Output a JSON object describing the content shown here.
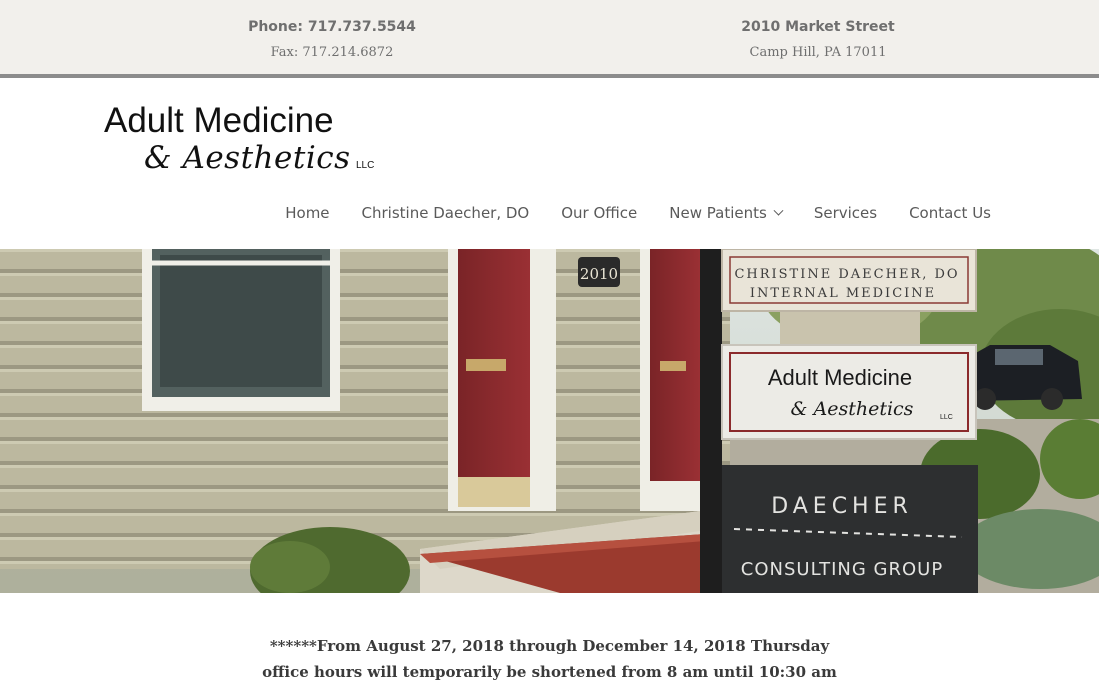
{
  "contact": {
    "phone": "Phone: 717.737.5544",
    "fax": "Fax: 717.214.6872",
    "street": "2010 Market Street",
    "city": "Camp Hill, PA 17011"
  },
  "logo": {
    "line1": "Adult Medicine",
    "line2": "& Aesthetics",
    "suffix": "LLC"
  },
  "nav": {
    "items": [
      {
        "label": "Home"
      },
      {
        "label": "Christine Daecher, DO"
      },
      {
        "label": "Our Office"
      },
      {
        "label": "New Patients",
        "has_dropdown": true
      },
      {
        "label": "Services"
      },
      {
        "label": "Contact Us"
      }
    ]
  },
  "hero": {
    "address_plaque": "2010",
    "sign_top_line1": "CHRISTINE DAECHER, DO",
    "sign_top_line2": "INTERNAL MEDICINE",
    "sign_mid_line1": "Adult Medicine",
    "sign_mid_line2": "& Aesthetics",
    "sign_mid_suffix": "LLC",
    "sign_bottom_line1": "DAECHER",
    "sign_bottom_line2": "CONSULTING GROUP"
  },
  "notice": {
    "line1": "******From August 27, 2018 through December 14, 2018 Thursday",
    "line2": "office hours will temporarily be shortened from 8 am until 10:30 am"
  },
  "colors": {
    "topbar_bg": "#f2f0ec",
    "topbar_border": "#8c8c8c",
    "nav_text": "#5a5a5a",
    "siding": "#b9b59c",
    "door": "#8a2a2c"
  }
}
